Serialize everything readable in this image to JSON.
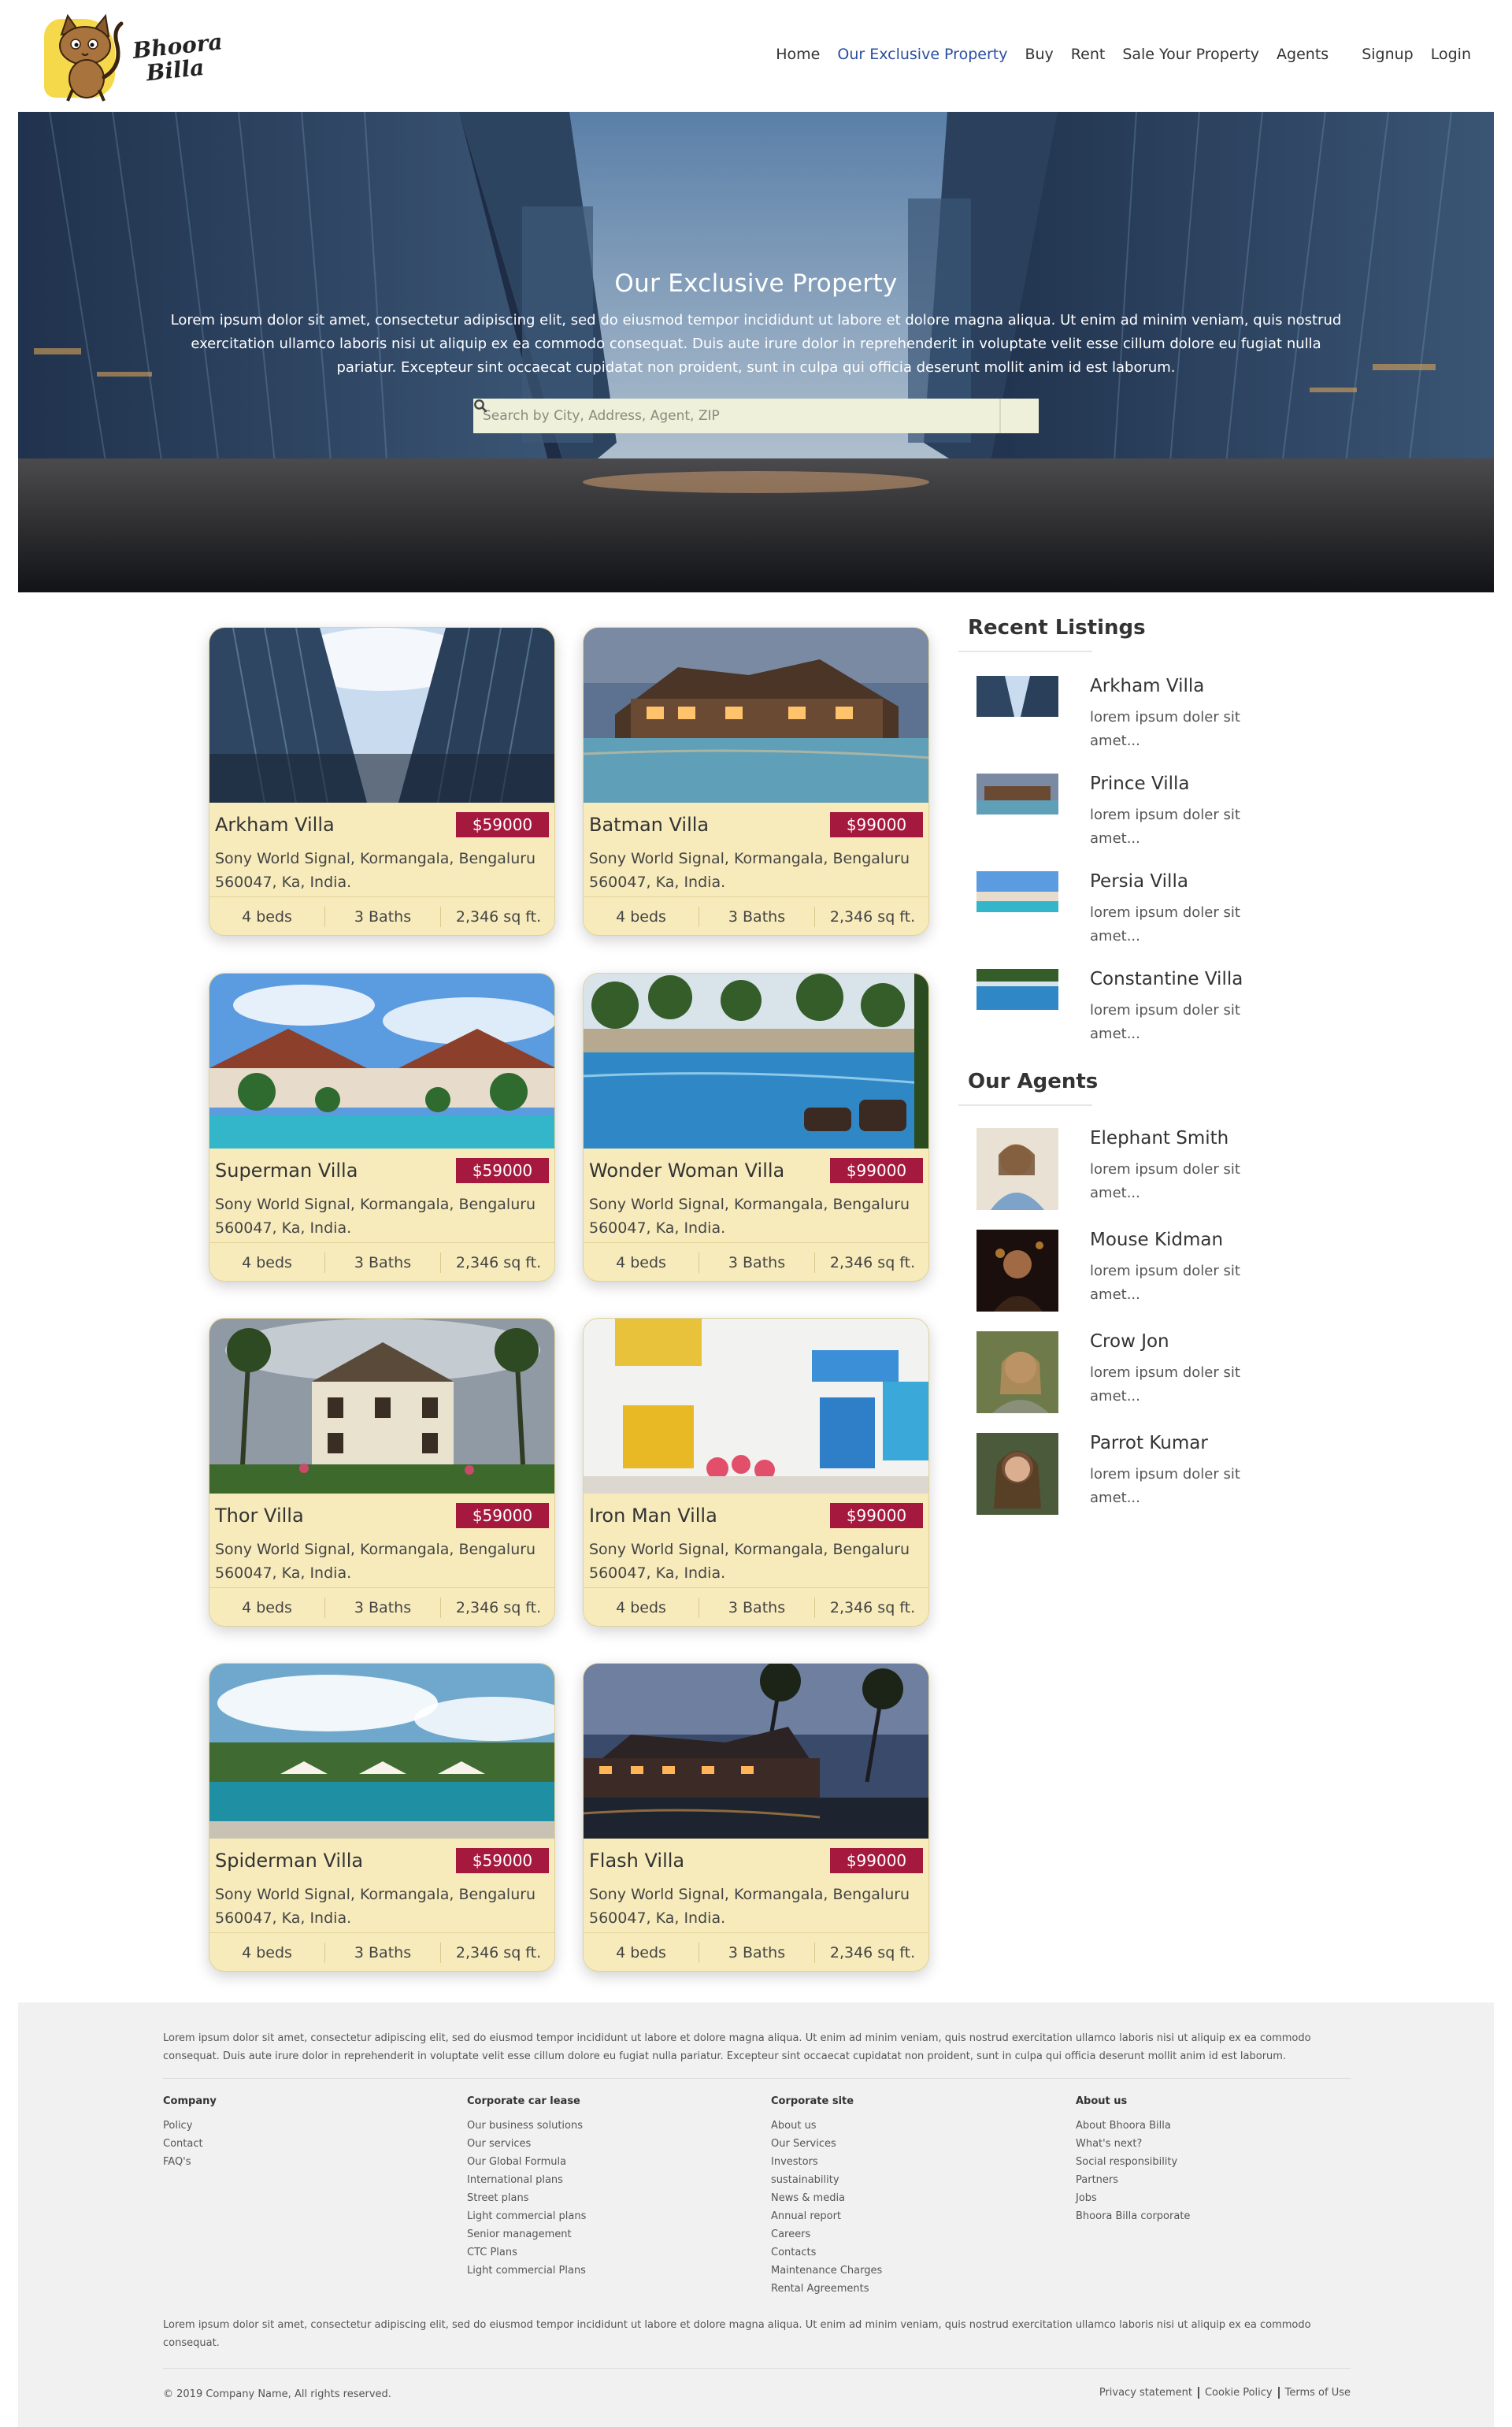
{
  "brand": {
    "logo_line1": "Bhoora",
    "logo_line2": "Billa"
  },
  "nav": {
    "items": [
      "Home",
      "Our Exclusive Property",
      "Buy",
      "Rent",
      "Sale Your Property",
      "Agents"
    ],
    "active": "Our Exclusive Property",
    "signup": "Signup",
    "login": "Login"
  },
  "hero": {
    "title": "Our Exclusive Property",
    "text": "Lorem ipsum dolor sit amet, consectetur adipiscing elit, sed do eiusmod tempor incididunt ut labore et dolore magna aliqua. Ut enim ad minim veniam, quis nostrud exercitation ullamco laboris nisi ut aliquip ex ea commodo consequat. Duis aute irure dolor in reprehenderit in voluptate velit esse cillum dolore eu fugiat nulla pariatur. Excepteur sint occaecat cupidatat non proident, sunt in culpa qui officia deserunt mollit anim id est laborum.",
    "search_placeholder": "Search by City, Address, Agent, ZIP",
    "search_icon": "search-icon"
  },
  "listings": [
    {
      "name": "Arkham Villa",
      "price": "$59000",
      "address": "Sony World Signal, Kormangala, Bengaluru 560047, Ka, India.",
      "beds": "4 beds",
      "baths": "3 Baths",
      "area": "2,346 sq ft."
    },
    {
      "name": "Batman Villa",
      "price": "$99000",
      "address": "Sony World Signal, Kormangala, Bengaluru 560047, Ka, India.",
      "beds": "4 beds",
      "baths": "3 Baths",
      "area": "2,346 sq ft."
    },
    {
      "name": "Superman Villa",
      "price": "$59000",
      "address": "Sony World Signal, Kormangala, Bengaluru 560047, Ka, India.",
      "beds": "4 beds",
      "baths": "3 Baths",
      "area": "2,346 sq ft."
    },
    {
      "name": "Wonder Woman Villa",
      "price": "$99000",
      "address": "Sony World Signal, Kormangala, Bengaluru 560047, Ka, India.",
      "beds": "4 beds",
      "baths": "3 Baths",
      "area": "2,346 sq ft."
    },
    {
      "name": "Thor Villa",
      "price": "$59000",
      "address": "Sony World Signal, Kormangala, Bengaluru 560047, Ka, India.",
      "beds": "4 beds",
      "baths": "3 Baths",
      "area": "2,346 sq ft."
    },
    {
      "name": "Iron Man Villa",
      "price": "$99000",
      "address": "Sony World Signal, Kormangala, Bengaluru 560047, Ka, India.",
      "beds": "4 beds",
      "baths": "3 Baths",
      "area": "2,346 sq ft."
    },
    {
      "name": "Spiderman Villa",
      "price": "$59000",
      "address": "Sony World Signal, Kormangala, Bengaluru 560047, Ka, India.",
      "beds": "4 beds",
      "baths": "3 Baths",
      "area": "2,346 sq ft."
    },
    {
      "name": "Flash Villa",
      "price": "$99000",
      "address": "Sony World Signal, Kormangala, Bengaluru 560047, Ka, India.",
      "beds": "4 beds",
      "baths": "3 Baths",
      "area": "2,346 sq ft."
    }
  ],
  "sidebar": {
    "recent_heading": "Recent Listings",
    "recent": [
      {
        "title": "Arkham Villa",
        "desc": "lorem ipsum doler sit amet..."
      },
      {
        "title": "Prince Villa",
        "desc": "lorem ipsum doler sit amet..."
      },
      {
        "title": "Persia Villa",
        "desc": "lorem ipsum doler sit amet..."
      },
      {
        "title": "Constantine Villa",
        "desc": "lorem ipsum doler sit amet..."
      }
    ],
    "agents_heading": "Our Agents",
    "agents": [
      {
        "name": "Elephant Smith",
        "desc": "lorem ipsum doler sit amet..."
      },
      {
        "name": "Mouse Kidman",
        "desc": "lorem ipsum doler sit amet..."
      },
      {
        "name": "Crow Jon",
        "desc": "lorem ipsum doler sit amet..."
      },
      {
        "name": "Parrot Kumar",
        "desc": "lorem ipsum doler sit amet..."
      }
    ]
  },
  "footer": {
    "top_text": "Lorem ipsum dolor sit amet, consectetur adipiscing elit, sed do eiusmod tempor incididunt ut labore et dolore magna aliqua. Ut enim ad minim veniam, quis nostrud exercitation ullamco laboris nisi ut aliquip ex ea commodo consequat. Duis aute irure dolor in reprehenderit in voluptate velit esse cillum dolore eu fugiat nulla pariatur. Excepteur sint occaecat cupidatat non proident, sunt in culpa qui officia deserunt mollit anim id est laborum.",
    "columns": [
      {
        "heading": "Company",
        "links": [
          "Policy",
          "Contact",
          "FAQ's"
        ]
      },
      {
        "heading": "Corporate car lease",
        "links": [
          "Our business solutions",
          "Our services",
          "Our Global Formula",
          "International plans",
          "Street plans",
          "Light commercial plans",
          "Senior management",
          "CTC Plans",
          "Light commercial Plans"
        ]
      },
      {
        "heading": "Corporate site",
        "links": [
          "About us",
          "Our Services",
          "Investors",
          "sustainability",
          "News & media",
          "Annual report",
          "Careers",
          "Contacts",
          "Maintenance Charges",
          "Rental Agreements"
        ]
      },
      {
        "heading": "About us",
        "links": [
          "About Bhoora Billa",
          "What's next?",
          "Social responsibility",
          "Partners",
          "Jobs",
          "Bhoora Billa corporate"
        ]
      }
    ],
    "bottom_text": "Lorem ipsum dolor sit amet, consectetur adipiscing elit, sed do eiusmod tempor incididunt ut labore et dolore magna aliqua. Ut enim ad minim veniam, quis nostrud exercitation ullamco laboris nisi ut aliquip ex ea commodo consequat.",
    "copyright": "© 2019 Company Name, All rights reserved.",
    "legal": [
      "Privacy statement",
      "Cookie Policy",
      "Terms of Use"
    ]
  }
}
